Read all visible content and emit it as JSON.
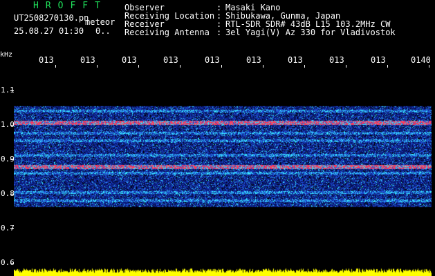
{
  "header": {
    "logo": "HROFFT",
    "filename": "UT2508270130.pn",
    "meteor_label": "meteor",
    "datetime": "25.08.27 01:30",
    "meteor_count": "0..",
    "info": [
      {
        "label": "Observer",
        "value": "Masaki Kano"
      },
      {
        "label": "Receiving Location",
        "value": "Shibukawa, Gunma, Japan"
      },
      {
        "label": "Receiver",
        "value": "RTL-SDR SDR# 43dB L15 103.2MHz CW"
      },
      {
        "label": "Receiving Antenna",
        "value": "3el Yagi(V) Az 330 for Vladivostok"
      }
    ],
    "separator": ":"
  },
  "axis": {
    "y_unit": "kHz",
    "y_labels": [
      "1.1",
      "1.0",
      "0.9",
      "0.8",
      "0.7",
      "0.6"
    ],
    "x_labels": [
      "013",
      "013",
      "013",
      "013",
      "013",
      "013",
      "013",
      "013",
      "013",
      "0140"
    ]
  },
  "colors": {
    "logo": "#1fe05a",
    "text": "#ffffff",
    "background": "#000000",
    "noise_dark": "#0a1a7a",
    "noise_mid": "#1f4fd6",
    "noise_cyan": "#36e6ff",
    "band_red": "#ff3a5a",
    "signal_yellow": "#ffff00"
  },
  "spectrogram": {
    "y_range_khz": [
      0.6,
      1.12
    ],
    "noise_band_khz": [
      0.775,
      1.025
    ],
    "strong_lines_khz": [
      0.875,
      0.985
    ],
    "medium_lines_khz": [
      0.79,
      0.81,
      0.86,
      0.905,
      0.94,
      0.96,
      1.015
    ],
    "signal_level_khz": 0.61
  }
}
